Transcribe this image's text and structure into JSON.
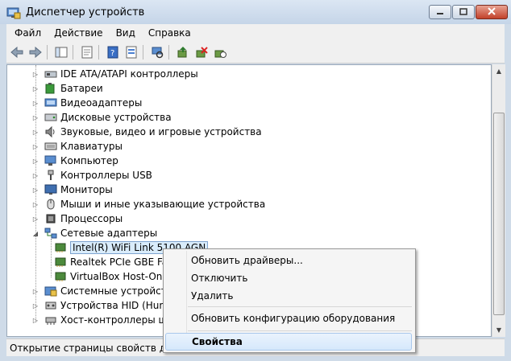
{
  "window": {
    "title": "Диспетчер устройств",
    "buttons": [
      "minimize",
      "maximize",
      "close"
    ]
  },
  "menubar": [
    {
      "label": "Файл"
    },
    {
      "label": "Действие"
    },
    {
      "label": "Вид"
    },
    {
      "label": "Справка"
    }
  ],
  "toolbar": [
    "back-arrow-icon",
    "forward-arrow-icon",
    "show-hide-tree-icon",
    "properties-icon",
    "help-icon",
    "details-icon",
    "scan-hardware-icon",
    "update-driver-icon",
    "disable-device-icon",
    "uninstall-device-icon"
  ],
  "tree": [
    {
      "label": "IDE ATA/ATAPI контроллеры",
      "icon": "ide-controller-icon",
      "expanded": false,
      "level": 0
    },
    {
      "label": "Батареи",
      "icon": "battery-icon",
      "expanded": false,
      "level": 0
    },
    {
      "label": "Видеоадаптеры",
      "icon": "display-adapter-icon",
      "expanded": false,
      "level": 0
    },
    {
      "label": "Дисковые устройства",
      "icon": "disk-drive-icon",
      "expanded": false,
      "level": 0
    },
    {
      "label": "Звуковые, видео и игровые устройства",
      "icon": "sound-icon",
      "expanded": false,
      "level": 0
    },
    {
      "label": "Клавиатуры",
      "icon": "keyboard-icon",
      "expanded": false,
      "level": 0
    },
    {
      "label": "Компьютер",
      "icon": "computer-icon",
      "expanded": false,
      "level": 0
    },
    {
      "label": "Контроллеры USB",
      "icon": "usb-icon",
      "expanded": false,
      "level": 0
    },
    {
      "label": "Мониторы",
      "icon": "monitor-icon",
      "expanded": false,
      "level": 0
    },
    {
      "label": "Мыши и иные указывающие устройства",
      "icon": "mouse-icon",
      "expanded": false,
      "level": 0
    },
    {
      "label": "Процессоры",
      "icon": "processor-icon",
      "expanded": false,
      "level": 0
    },
    {
      "label": "Сетевые адаптеры",
      "icon": "network-adapter-icon",
      "expanded": true,
      "level": 0
    },
    {
      "label": "Intel(R) WiFi Link 5100 AGN",
      "icon": "network-card-icon",
      "level": 1,
      "selected": true
    },
    {
      "label": "Realtek PCIe GBE Fan",
      "icon": "network-card-icon",
      "level": 1
    },
    {
      "label": "VirtualBox Host-Only",
      "icon": "network-card-icon",
      "level": 1
    },
    {
      "label": "Системные устройства",
      "icon": "system-device-icon",
      "expanded": false,
      "level": 0
    },
    {
      "label": "Устройства HID (Human",
      "icon": "hid-icon",
      "expanded": false,
      "level": 0
    },
    {
      "label": "Хост-контроллеры шин",
      "icon": "bus-controller-icon",
      "expanded": false,
      "level": 0
    }
  ],
  "status": "Открытие страницы свойств для вы",
  "context_menu": {
    "items": [
      {
        "label": "Обновить драйверы...",
        "name": "ctx-update-drivers"
      },
      {
        "label": "Отключить",
        "name": "ctx-disable"
      },
      {
        "label": "Удалить",
        "name": "ctx-uninstall"
      },
      {
        "separator": true
      },
      {
        "label": "Обновить конфигурацию оборудования",
        "name": "ctx-scan-hardware"
      },
      {
        "separator": true
      },
      {
        "label": "Свойства",
        "name": "ctx-properties",
        "highlighted": true
      }
    ]
  },
  "colors": {
    "accent": "#3399ff",
    "selection": "#d9ecfb",
    "close_button": "#c2412a"
  }
}
